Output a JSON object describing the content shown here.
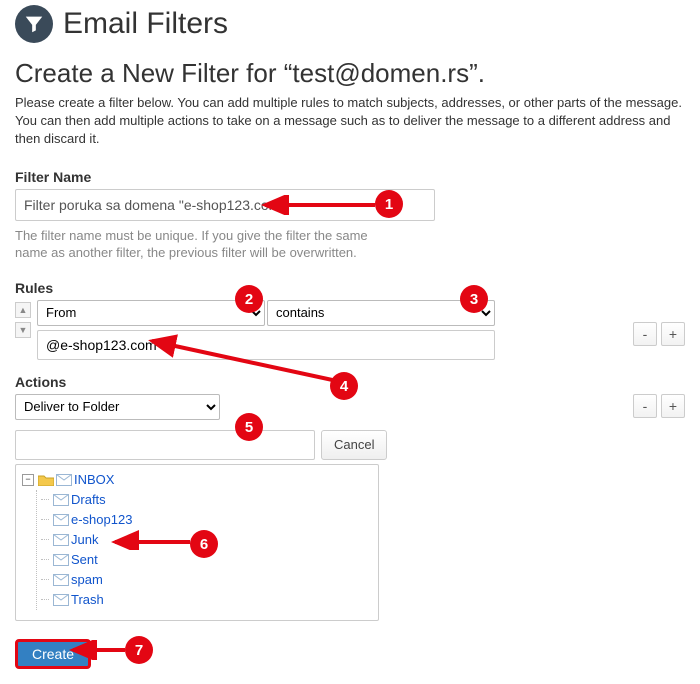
{
  "header": {
    "title": "Email Filters"
  },
  "subtitle": "Create a New Filter for “test@domen.rs”.",
  "intro": "Please create a filter below. You can add multiple rules to match subjects, addresses, or other parts of the message. You can then add multiple actions to take on a message such as to deliver the message to a different address and then discard it.",
  "filterName": {
    "label": "Filter Name",
    "value": "Filter poruka sa domena \"e-shop123.com\"",
    "help": "The filter name must be unique. If you give the filter the same name as another filter, the previous filter will be overwritten."
  },
  "rules": {
    "label": "Rules",
    "field": "From",
    "condition": "contains",
    "value": "@e-shop123.com",
    "minus": "-",
    "plus": "+"
  },
  "actions": {
    "label": "Actions",
    "selected": "Deliver to Folder",
    "minus": "-",
    "plus": "+",
    "cancel": "Cancel",
    "pathValue": ""
  },
  "tree": {
    "root": "INBOX",
    "children": [
      "Drafts",
      "e-shop123",
      "Junk",
      "Sent",
      "spam",
      "Trash"
    ]
  },
  "createLabel": "Create",
  "callouts": {
    "c1": "1",
    "c2": "2",
    "c3": "3",
    "c4": "4",
    "c5": "5",
    "c6": "6",
    "c7": "7"
  }
}
